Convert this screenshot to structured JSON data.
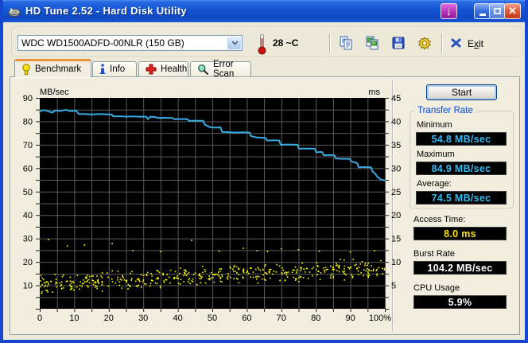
{
  "window": {
    "title": "HD Tune 2.52 - Hard Disk Utility",
    "icon": "hard-disk-icon",
    "controls": [
      "screenshot-download-button",
      "minimize-button",
      "maximize-button",
      "close-button"
    ]
  },
  "toolbar": {
    "drive_select": {
      "value": "WDC WD1500ADFD-00NLR (150 GB)"
    },
    "temperature": "28 ~C",
    "buttons": [
      "copy-text",
      "copy-image",
      "save",
      "options"
    ],
    "exit": {
      "pre": "E",
      "accel": "x",
      "post": "it"
    }
  },
  "tabs": [
    {
      "label": "Benchmark",
      "icon": "lightbulb-icon",
      "active": true
    },
    {
      "label": "Info",
      "icon": "info-icon",
      "active": false
    },
    {
      "label": "Health",
      "icon": "health-cross-icon",
      "active": false
    },
    {
      "label": "Error Scan",
      "icon": "magnifier-icon",
      "active": false
    }
  ],
  "controls_panel": {
    "start_button": "Start",
    "transfer_rate": {
      "title": "Transfer Rate",
      "items": [
        {
          "label": "Minimum",
          "value": "54.8 MB/sec",
          "color": "#35B9F1"
        },
        {
          "label": "Maximum",
          "value": "84.9 MB/sec",
          "color": "#35B9F1"
        },
        {
          "label": "Average:",
          "value": "74.5 MB/sec",
          "color": "#35B9F1"
        }
      ]
    },
    "extras": [
      {
        "label": "Access Time:",
        "value": "8.0 ms",
        "color": "#FFE000"
      },
      {
        "label": "Burst Rate",
        "value": "104.2 MB/sec",
        "color": "#FFFFFF"
      },
      {
        "label": "CPU Usage",
        "value": "5.9%",
        "color": "#FFFFFF"
      }
    ]
  },
  "chart_data": {
    "type": "line+scatter",
    "title": "HD Tune read benchmark",
    "bg": "#000000",
    "grid_color": "#5A5A5A",
    "grid": true,
    "x_axis": {
      "min": 0,
      "max": 100,
      "grid_step": 5,
      "ticks": [
        [
          0,
          "0"
        ],
        [
          10,
          "10"
        ],
        [
          20,
          "20"
        ],
        [
          30,
          "30"
        ],
        [
          40,
          "40"
        ],
        [
          50,
          "50"
        ],
        [
          60,
          "60"
        ],
        [
          70,
          "70"
        ],
        [
          80,
          "80"
        ],
        [
          90,
          "90"
        ],
        [
          100,
          "100%"
        ]
      ]
    },
    "left_axis": {
      "label": "MB/sec",
      "min": 0,
      "max": 90,
      "grid_step": 5,
      "ticks": [
        [
          10,
          "10"
        ],
        [
          20,
          "20"
        ],
        [
          30,
          "30"
        ],
        [
          40,
          "40"
        ],
        [
          50,
          "50"
        ],
        [
          60,
          "60"
        ],
        [
          70,
          "70"
        ],
        [
          80,
          "80"
        ],
        [
          90,
          "90"
        ]
      ]
    },
    "right_axis": {
      "label": "ms",
      "min": 0,
      "max": 45,
      "grid_step": 2.5,
      "ticks": [
        [
          5,
          "5"
        ],
        [
          10,
          "10"
        ],
        [
          15,
          "15"
        ],
        [
          20,
          "20"
        ],
        [
          25,
          "25"
        ],
        [
          30,
          "30"
        ],
        [
          35,
          "35"
        ],
        [
          40,
          "40"
        ],
        [
          45,
          "45"
        ]
      ]
    },
    "transfer_line": {
      "name": "Transfer rate",
      "unit": "MB/sec",
      "axis": "left",
      "color": "#38AADF",
      "points": [
        [
          0,
          84.2
        ],
        [
          1,
          84.8
        ],
        [
          2.5,
          84.3
        ],
        [
          3.6,
          83.7
        ],
        [
          4.5,
          84.6
        ],
        [
          6,
          84.4
        ],
        [
          7.5,
          84.9
        ],
        [
          9,
          84.3
        ],
        [
          10.5,
          84.6
        ],
        [
          11.3,
          83.1
        ],
        [
          13,
          83.1
        ],
        [
          15,
          82.9
        ],
        [
          17,
          83.1
        ],
        [
          19,
          83.0
        ],
        [
          20.9,
          82.9
        ],
        [
          21.3,
          82.1
        ],
        [
          23,
          82.2
        ],
        [
          25,
          82.0
        ],
        [
          27,
          82.1
        ],
        [
          29,
          82.0
        ],
        [
          30.9,
          82.0
        ],
        [
          31.3,
          80.9
        ],
        [
          32,
          81.9
        ],
        [
          33.5,
          81.8
        ],
        [
          34.2,
          81.4
        ],
        [
          36,
          81.5
        ],
        [
          38.5,
          81.4
        ],
        [
          39,
          80.9
        ],
        [
          41,
          81.0
        ],
        [
          42.8,
          80.9
        ],
        [
          43.2,
          80.2
        ],
        [
          45,
          80.3
        ],
        [
          47.4,
          80.2
        ],
        [
          47.8,
          78.6
        ],
        [
          49.3,
          77.5
        ],
        [
          50.5,
          77.3
        ],
        [
          52.4,
          77.4
        ],
        [
          52.8,
          75.5
        ],
        [
          54.5,
          75.4
        ],
        [
          56.5,
          75.2
        ],
        [
          58.5,
          75.3
        ],
        [
          60.8,
          75.2
        ],
        [
          61.2,
          73.7
        ],
        [
          63,
          73.1
        ],
        [
          65.4,
          73.0
        ],
        [
          65.8,
          71.8
        ],
        [
          67.5,
          71.9
        ],
        [
          69.4,
          71.8
        ],
        [
          69.8,
          70.0
        ],
        [
          72,
          70.1
        ],
        [
          74.7,
          70.0
        ],
        [
          75.1,
          68.3
        ],
        [
          77,
          68.4
        ],
        [
          79.7,
          68.3
        ],
        [
          80.1,
          66.8
        ],
        [
          81.8,
          66.9
        ],
        [
          82.3,
          65.5
        ],
        [
          84,
          65.6
        ],
        [
          85.4,
          65.5
        ],
        [
          85.8,
          64.1
        ],
        [
          88,
          64.0
        ],
        [
          89.8,
          64.0
        ],
        [
          90.2,
          62.9
        ],
        [
          92,
          62.1
        ],
        [
          92.4,
          60.4
        ],
        [
          94,
          60.5
        ],
        [
          96,
          60.4
        ],
        [
          96.4,
          58.7
        ],
        [
          97.3,
          57.5
        ],
        [
          97.7,
          56.5
        ],
        [
          98.4,
          55.6
        ],
        [
          99.2,
          55.0
        ],
        [
          100,
          54.8
        ]
      ]
    },
    "access_scatter": {
      "name": "Access time",
      "unit": "ms",
      "axis": "right",
      "color": "#FFFF00",
      "count": 460,
      "seed": 11,
      "trend_start_ms": 5.3,
      "trend_end_ms": 8.8,
      "jitter_ms": 2.3,
      "outliers": [
        [
          2.5,
          14.8
        ],
        [
          8,
          13.4
        ],
        [
          13,
          13.6
        ],
        [
          21,
          13.9
        ],
        [
          27,
          12.4
        ],
        [
          35,
          12.2
        ],
        [
          44,
          14.6
        ],
        [
          52,
          12.3
        ],
        [
          59,
          12.9
        ],
        [
          63,
          12.4
        ],
        [
          66,
          12.2
        ],
        [
          70,
          12.8
        ],
        [
          75,
          12.6
        ],
        [
          81,
          12.3
        ],
        [
          90,
          12.1
        ],
        [
          97,
          12.4
        ]
      ]
    }
  }
}
